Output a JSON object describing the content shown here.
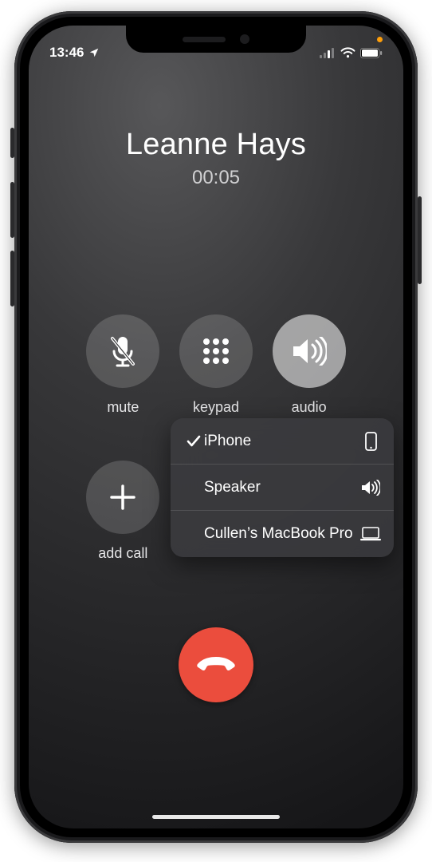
{
  "status": {
    "time": "13:46"
  },
  "caller": {
    "name": "Leanne Hays",
    "timer": "00:05"
  },
  "controls": {
    "mute": {
      "label": "mute"
    },
    "keypad": {
      "label": "keypad"
    },
    "audio": {
      "label": "audio"
    },
    "addcall": {
      "label": "add call"
    }
  },
  "audio_routes": {
    "items": {
      "iphone": {
        "label": "iPhone",
        "selected": true
      },
      "speaker": {
        "label": "Speaker",
        "selected": false
      },
      "mac": {
        "label": "Cullen’s MacBook Pro",
        "selected": false
      }
    }
  }
}
